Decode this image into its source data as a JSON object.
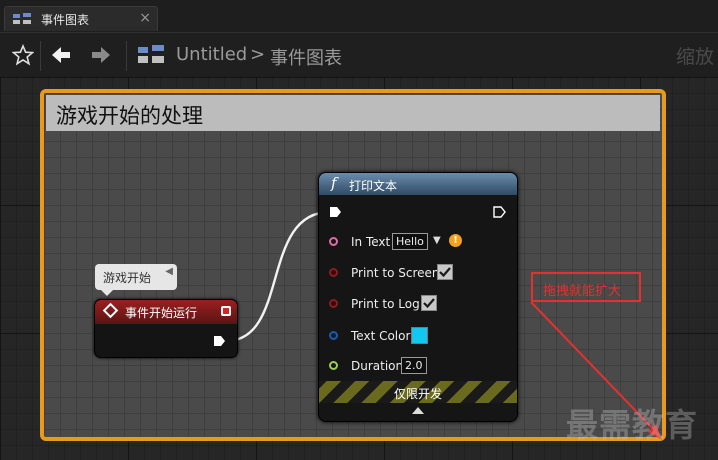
{
  "tab": {
    "label": "事件图表",
    "close": "×"
  },
  "breadcrumb": {
    "root": "Untitled",
    "separator": ">",
    "current": "事件图表"
  },
  "zoom_label": "缩放",
  "comment": {
    "title": "游戏开始的处理"
  },
  "bubble": {
    "text": "游戏开始"
  },
  "event_node": {
    "title": "事件开始运行"
  },
  "print_node": {
    "fn_symbol": "f",
    "title": "打印文本",
    "rows": {
      "in_text": {
        "label": "In Text",
        "value": "Hello"
      },
      "print_to_screen": {
        "label": "Print to Screen",
        "checked": true
      },
      "print_to_log": {
        "label": "Print to Log",
        "checked": true
      },
      "text_color": {
        "label": "Text Color",
        "swatch": "#13c8f0"
      },
      "duration": {
        "label": "Duration",
        "value": "2.0"
      }
    },
    "dev_only_label": "仅限开发"
  },
  "annotation": {
    "text": "拖拽就能扩大",
    "color": "#e53030"
  },
  "watermark": "最需教育",
  "colors": {
    "comment_border": "#e89a1c",
    "event_header": "#8a1e1e",
    "function_header": "#4a6e8f"
  }
}
